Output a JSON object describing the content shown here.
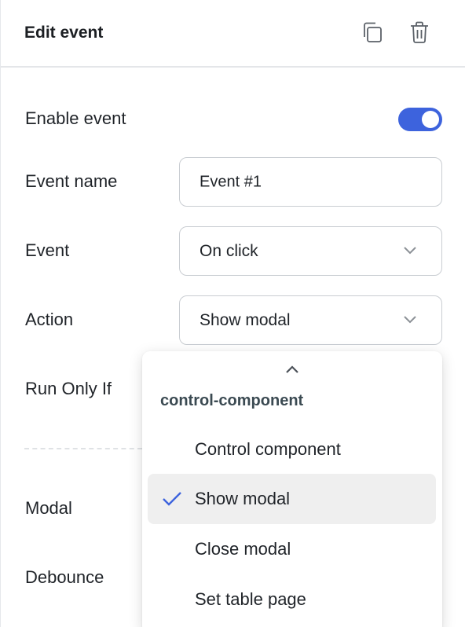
{
  "header": {
    "title": "Edit event",
    "copy_icon": "copy-icon",
    "trash_icon": "trash-icon"
  },
  "form": {
    "enable_label": "Enable event",
    "enable_value": true,
    "name_label": "Event name",
    "name_value": "Event #1",
    "event_label": "Event",
    "event_value": "On click",
    "action_label": "Action",
    "action_value": "Show modal",
    "run_only_if_label": "Run Only If",
    "modal_label": "Modal",
    "debounce_label": "Debounce"
  },
  "dropdown": {
    "group_label": "control-component",
    "items": [
      {
        "label": "Control component",
        "selected": false
      },
      {
        "label": "Show modal",
        "selected": true
      },
      {
        "label": "Close modal",
        "selected": false
      },
      {
        "label": "Set table page",
        "selected": false
      }
    ]
  },
  "colors": {
    "accent": "#3d63dd",
    "selected_bg": "#efefef",
    "border": "#c9cdd2"
  }
}
